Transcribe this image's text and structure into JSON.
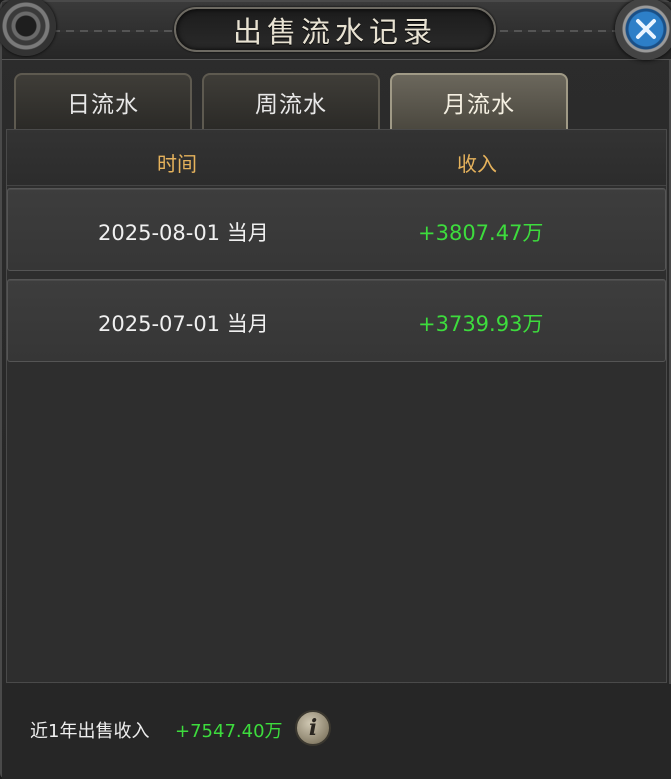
{
  "window": {
    "title": "出售流水记录"
  },
  "tabs": [
    {
      "label": "日流水",
      "active": false
    },
    {
      "label": "周流水",
      "active": false
    },
    {
      "label": "月流水",
      "active": true
    }
  ],
  "table": {
    "columns": [
      "时间",
      "收入"
    ],
    "rows": [
      {
        "time": "2025-08-01 当月",
        "income": "+3807.47万"
      },
      {
        "time": "2025-07-01 当月",
        "income": "+3739.93万"
      }
    ]
  },
  "footer": {
    "label": "近1年出售收入",
    "value": "+7547.40万",
    "info_icon": "i"
  },
  "colors": {
    "income_green": "#3ddc3d",
    "header_gold": "#e5b25c",
    "close_blue": "#2d7fc8"
  },
  "icons": {
    "close": "close-icon",
    "info": "info-icon",
    "corner": "ornament-icon"
  }
}
